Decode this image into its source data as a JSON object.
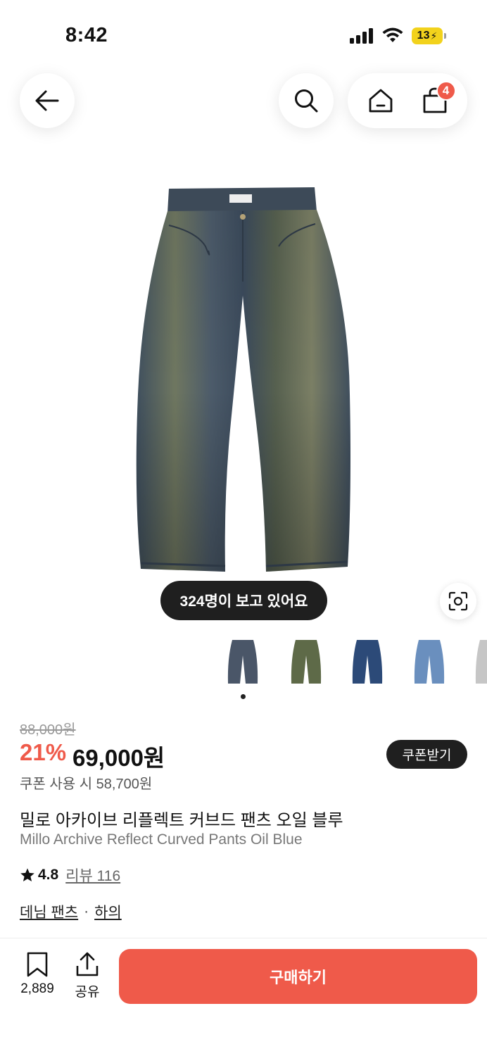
{
  "status_bar": {
    "time": "8:42",
    "battery": "13"
  },
  "header": {
    "cart_count": "4"
  },
  "product": {
    "viewers_text": "324명이 보고 있어요",
    "thumbnails": [
      {
        "name": "dark-wash",
        "color": "#4a5668"
      },
      {
        "name": "olive",
        "color": "#5e6a48"
      },
      {
        "name": "blue",
        "color": "#2c4a78"
      },
      {
        "name": "light-blue",
        "color": "#6a8fbe"
      },
      {
        "name": "grey",
        "color": "#c6c6c6"
      }
    ],
    "original_price": "88,000원",
    "discount": "21%",
    "price": "69,000원",
    "coupon_button": "쿠폰받기",
    "coupon_price": "쿠폰 사용 시 58,700원",
    "title_ko": "밀로 아카이브 리플렉트 커브드 팬츠 오일 블루",
    "title_en": "Millo Archive Reflect Curved Pants Oil Blue",
    "rating": "4.8",
    "reviews": "리뷰 116",
    "category": {
      "primary": "데님 팬츠",
      "separator": "·",
      "secondary": "하의"
    }
  },
  "bottom_bar": {
    "bookmark_count": "2,889",
    "share_label": "공유",
    "buy_label": "구매하기"
  },
  "colors": {
    "accent": "#ef5a4a",
    "dark": "#1f1f1f"
  }
}
